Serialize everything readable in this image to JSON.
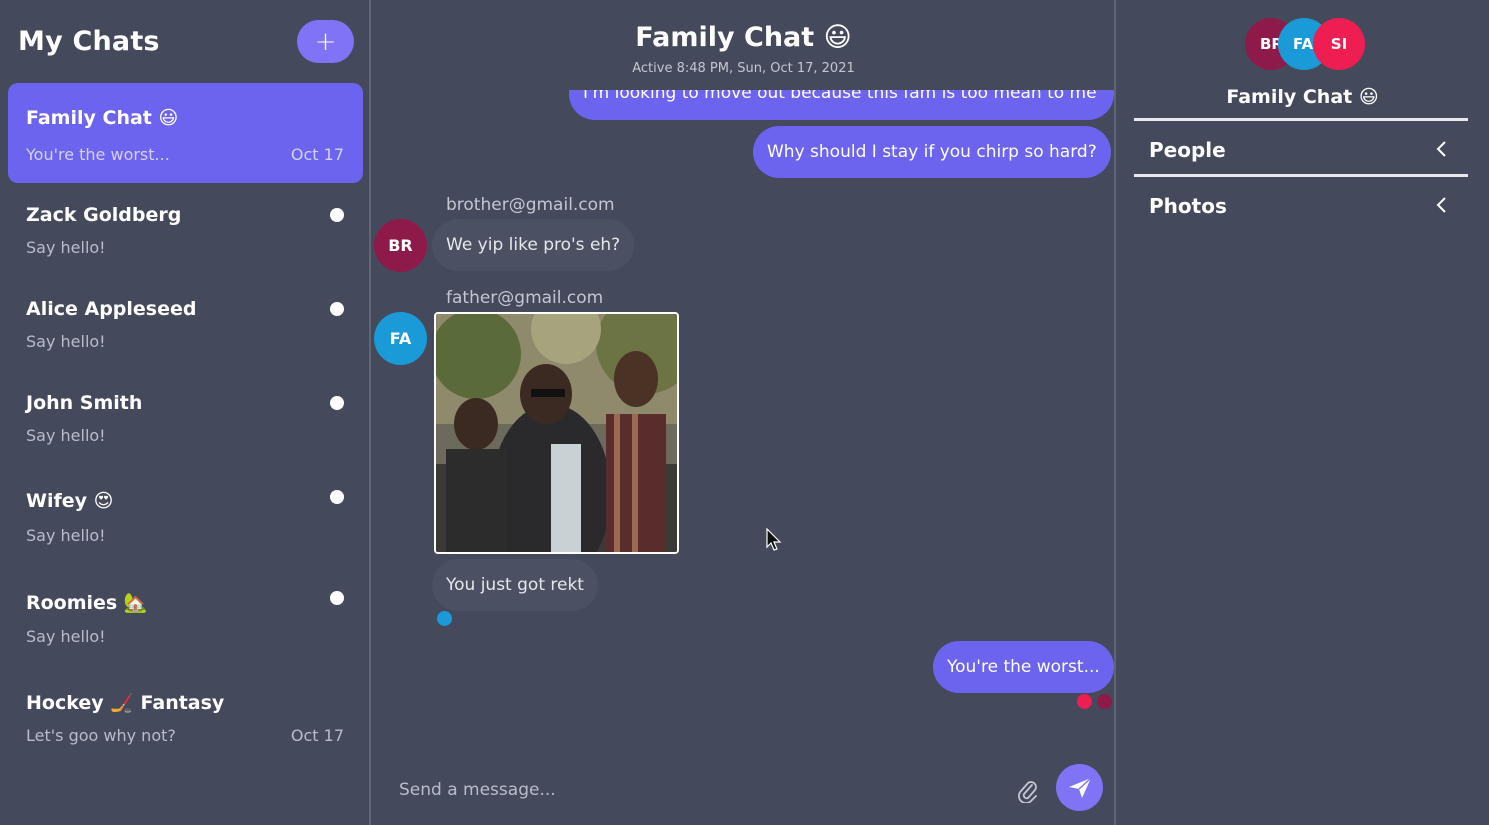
{
  "sidebar": {
    "title": "My Chats",
    "new_chat_label": "+",
    "chats": [
      {
        "name": "Family Chat 😃",
        "preview": "You're the worst...",
        "date": "Oct 17",
        "active": true,
        "unread": false
      },
      {
        "name": "Zack Goldberg",
        "preview": "Say hello!",
        "date": "",
        "active": false,
        "unread": true
      },
      {
        "name": "Alice Appleseed",
        "preview": "Say hello!",
        "date": "",
        "active": false,
        "unread": true
      },
      {
        "name": "John Smith",
        "preview": "Say hello!",
        "date": "",
        "active": false,
        "unread": true
      },
      {
        "name": "Wifey 😍",
        "preview": "Say hello!",
        "date": "",
        "active": false,
        "unread": true
      },
      {
        "name": "Roomies 🏡",
        "preview": "Say hello!",
        "date": "",
        "active": false,
        "unread": true
      },
      {
        "name": "Hockey 🏒 Fantasy",
        "preview": "Let's goo why not?",
        "date": "Oct 17",
        "active": false,
        "unread": false
      }
    ]
  },
  "chat": {
    "title": "Family Chat 😃",
    "subtitle": "Active 8:48 PM, Sun, Oct 17, 2021",
    "messages": {
      "cut_mine": "I'm looking to move out because this fam is too mean to me",
      "mine_1": "Why should I stay if you chirp so hard?",
      "brother_email": "brother@gmail.com",
      "brother_avatar": "BR",
      "brother_text": "We yip like pro's eh?",
      "father_email": "father@gmail.com",
      "father_avatar": "FA",
      "father_text": "You just got rekt",
      "mine_2": "You're the worst..."
    },
    "composer": {
      "placeholder": "Send a message..."
    }
  },
  "details": {
    "avatars": [
      "BR",
      "FA",
      "SI"
    ],
    "title": "Family Chat 😃",
    "sections": [
      "People",
      "Photos"
    ]
  },
  "colors": {
    "background": "#444a5c",
    "accent": "#6c63ef",
    "button": "#7f74f6",
    "brother": "#8e1a4a",
    "father": "#1a9ad6",
    "sister": "#ee1d52"
  }
}
